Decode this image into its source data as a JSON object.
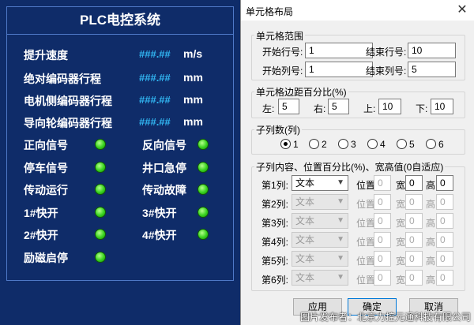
{
  "plc": {
    "title": "PLC电控系统",
    "measures": [
      {
        "label": "提升速度",
        "value": "###.##",
        "unit": "m/s"
      },
      {
        "label": "绝对编码器行程",
        "value": "###.##",
        "unit": "mm"
      },
      {
        "label": "电机侧编码器行程",
        "value": "###.##",
        "unit": "mm"
      },
      {
        "label": "导向轮编码器行程",
        "value": "###.##",
        "unit": "mm"
      }
    ],
    "signals": [
      {
        "label": "正向信号"
      },
      {
        "label": "反向信号"
      },
      {
        "label": "停车信号"
      },
      {
        "label": "井口急停"
      },
      {
        "label": "传动运行"
      },
      {
        "label": "传动故障"
      },
      {
        "label": "1#快开"
      },
      {
        "label": "3#快开"
      },
      {
        "label": "2#快开"
      },
      {
        "label": "4#快开"
      },
      {
        "label": "励磁启停"
      }
    ],
    "led_color": "#37d21e"
  },
  "dialog": {
    "title": "单元格布局",
    "range_group": {
      "label": "单元格范围",
      "start_row_label": "开始行号:",
      "start_row": "1",
      "end_row_label": "结束行号:",
      "end_row": "10",
      "start_col_label": "开始列号:",
      "start_col": "1",
      "end_col_label": "结束列号:",
      "end_col": "5"
    },
    "margin_group": {
      "label": "单元格边距百分比(%)",
      "left_label": "左:",
      "left": "5",
      "right_label": "右:",
      "right": "5",
      "top_label": "上:",
      "top": "10",
      "bottom_label": "下:",
      "bottom": "10"
    },
    "subcol_group": {
      "label": "子列数(列)",
      "options": [
        "1",
        "2",
        "3",
        "4",
        "5",
        "6"
      ],
      "selected": "1"
    },
    "content_group": {
      "label": "子列内容、位置百分比(%)、宽高值(0自适应)",
      "pos_label": "位置",
      "width_label": "宽",
      "height_label": "高",
      "rows": [
        {
          "label": "第1列:",
          "type": "文本",
          "pos": "0",
          "width": "0",
          "height": "0"
        },
        {
          "label": "第2列:",
          "type": "文本",
          "pos": "0",
          "width": "0",
          "height": "0"
        },
        {
          "label": "第3列:",
          "type": "文本",
          "pos": "0",
          "width": "0",
          "height": "0"
        },
        {
          "label": "第4列:",
          "type": "文本",
          "pos": "0",
          "width": "0",
          "height": "0"
        },
        {
          "label": "第5列:",
          "type": "文本",
          "pos": "0",
          "width": "0",
          "height": "0"
        },
        {
          "label": "第6列:",
          "type": "文本",
          "pos": "0",
          "width": "0",
          "height": "0"
        }
      ]
    },
    "buttons": {
      "apply": "应用",
      "ok": "确定",
      "cancel": "取消"
    },
    "accent": "#0078d7"
  },
  "watermark": "图片发布者：北京力控元通科技有限公司"
}
